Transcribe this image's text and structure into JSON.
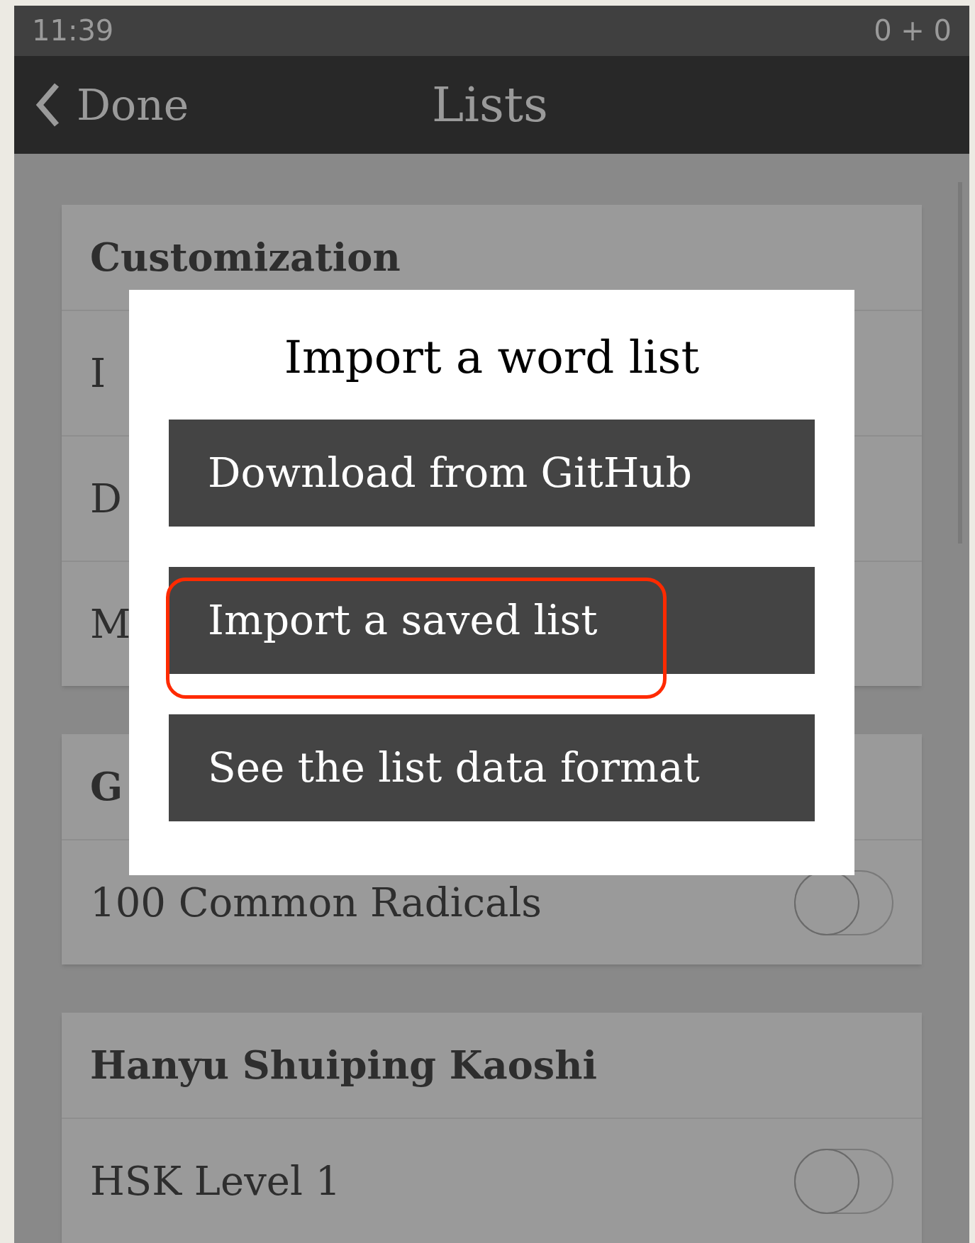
{
  "status_bar": {
    "time": "11:39",
    "counter": "0 + 0"
  },
  "nav": {
    "back": "Done",
    "title": "Lists"
  },
  "sections": [
    {
      "title": "Customization",
      "rows": [
        {
          "kind": "link",
          "label": "I"
        },
        {
          "kind": "link",
          "label": "D"
        },
        {
          "kind": "link",
          "label": "M"
        }
      ]
    },
    {
      "title": "G",
      "rows": [
        {
          "kind": "toggle",
          "label": "100 Common Radicals",
          "on": false
        }
      ]
    },
    {
      "title": "Hanyu Shuiping Kaoshi",
      "rows": [
        {
          "kind": "toggle",
          "label": "HSK Level 1",
          "on": false
        }
      ]
    }
  ],
  "dialog": {
    "title": "Import a word list",
    "buttons": [
      {
        "label": "Download from GitHub",
        "highlighted": false
      },
      {
        "label": "Import a saved list",
        "highlighted": true
      },
      {
        "label": "See the list data format",
        "highlighted": false
      }
    ]
  }
}
